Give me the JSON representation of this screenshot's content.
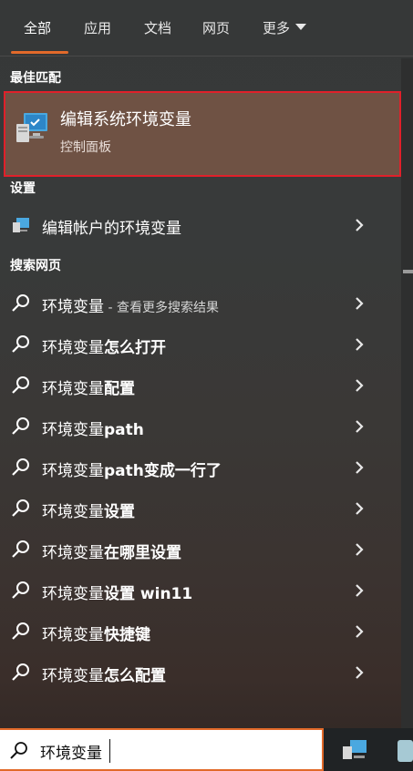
{
  "tabs": [
    {
      "label": "全部"
    },
    {
      "label": "应用"
    },
    {
      "label": "文档"
    },
    {
      "label": "网页"
    },
    {
      "label": "更多"
    }
  ],
  "best_match": {
    "section_title": "最佳匹配",
    "title": "编辑系统环境变量",
    "subtitle": "控制面板"
  },
  "settings": {
    "section_title": "设置",
    "items": [
      {
        "label": "编辑帐户的环境变量"
      }
    ]
  },
  "web": {
    "section_title": "搜索网页",
    "first": {
      "query": "环境变量",
      "suffix": " - 查看更多搜索结果"
    },
    "items": [
      {
        "prefix": "环境变量",
        "bold": "怎么打开"
      },
      {
        "prefix": "环境变量",
        "bold": "配置"
      },
      {
        "prefix": "环境变量",
        "bold": "path"
      },
      {
        "prefix": "环境变量",
        "bold": "path变成一行了"
      },
      {
        "prefix": "环境变量",
        "bold": "设置"
      },
      {
        "prefix": "环境变量",
        "bold": "在哪里设置"
      },
      {
        "prefix": "环境变量",
        "bold": "设置 win11"
      },
      {
        "prefix": "环境变量",
        "bold": "快捷键"
      },
      {
        "prefix": "环境变量",
        "bold": "怎么配置"
      }
    ]
  },
  "search": {
    "value": "环境变量"
  },
  "icons": {
    "search": "search-icon",
    "chevron": "chevron-right-icon",
    "monitor": "monitor-icon"
  },
  "colors": {
    "accent": "#e26a2a",
    "highlight_border": "#e0202a",
    "selected_bg": "#6f5244"
  }
}
